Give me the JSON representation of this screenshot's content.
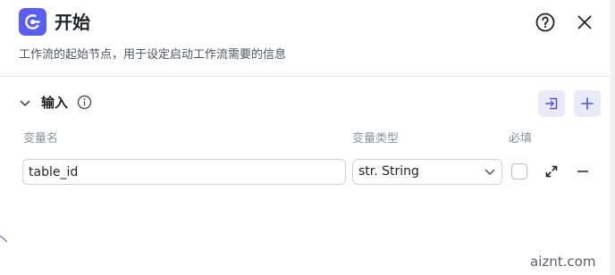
{
  "header": {
    "icon": "start-node-icon",
    "title": "开始",
    "description": "工作流的起始节点，用于设定启动工作流需要的信息",
    "help_icon": "question-circle-icon",
    "close_icon": "close-icon"
  },
  "section": {
    "title": "输入",
    "collapse_icon": "chevron-down-icon",
    "info_icon": "info-circle-icon",
    "import_icon": "import-icon",
    "add_icon": "plus-icon"
  },
  "columns": {
    "name": "变量名",
    "type": "变量类型",
    "required": "必填"
  },
  "rows": [
    {
      "name": "table_id",
      "type": "str. String",
      "required": false
    }
  ],
  "watermark": "aiznt.com",
  "colors": {
    "accent": "#5b5ff0",
    "button_bg": "#e9ebfb"
  }
}
